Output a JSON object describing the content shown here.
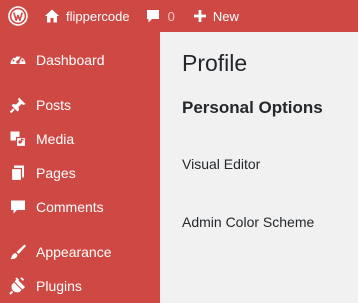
{
  "adminbar": {
    "logo_icon": "wordpress-logo-icon",
    "site_icon": "home-icon",
    "site_name": "flippercode",
    "comments_icon": "comment-bubble-icon",
    "comments_count": "0",
    "new_icon": "plus-icon",
    "new_label": "New"
  },
  "sidebar": {
    "items": [
      {
        "icon": "dashboard-gauge-icon",
        "label": "Dashboard"
      },
      {
        "icon": "pushpin-icon",
        "label": "Posts"
      },
      {
        "icon": "media-icon",
        "label": "Media"
      },
      {
        "icon": "pages-icon",
        "label": "Pages"
      },
      {
        "icon": "comment-bubble-icon",
        "label": "Comments"
      },
      {
        "icon": "paintbrush-icon",
        "label": "Appearance"
      },
      {
        "icon": "plug-icon",
        "label": "Plugins"
      }
    ]
  },
  "main": {
    "title": "Profile",
    "section": "Personal Options",
    "fields": [
      {
        "label": "Visual Editor"
      },
      {
        "label": "Admin Color Scheme"
      }
    ]
  },
  "colors": {
    "accent": "#cf4944",
    "background": "#f1f1f1",
    "text": "#23282d"
  }
}
